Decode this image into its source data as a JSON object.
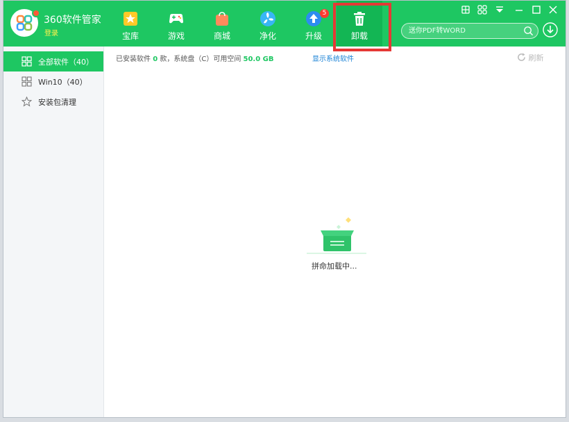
{
  "app": {
    "brand": "360软件管家",
    "login": "登录"
  },
  "tabs": [
    {
      "label": "宝库",
      "icon": "star-icon"
    },
    {
      "label": "游戏",
      "icon": "gamepad-icon"
    },
    {
      "label": "商城",
      "icon": "shopping-bag-icon"
    },
    {
      "label": "净化",
      "icon": "fan-icon"
    },
    {
      "label": "升级",
      "icon": "upgrade-arrow-icon",
      "badge": "5"
    },
    {
      "label": "卸载",
      "icon": "trash-icon",
      "active": true
    }
  ],
  "search": {
    "placeholder": "送你PDF转WORD"
  },
  "sidebar": {
    "items": [
      {
        "label": "全部软件（40）",
        "icon": "grid-icon",
        "active": true
      },
      {
        "label": "Win10（40）",
        "icon": "windows-grid-icon"
      },
      {
        "label": "安装包清理",
        "icon": "star-outline-icon"
      }
    ]
  },
  "status": {
    "prefix": "已安装软件",
    "count": "0",
    "middle": "款，系统盘（C）可用空间",
    "space": "50.0 GB"
  },
  "show_system": "显示系统软件",
  "refresh": "刷新",
  "loading": "拼命加载中...",
  "colors": {
    "brand_green": "#1ec762",
    "highlight_red": "#e53935",
    "link_blue": "#1a82d6"
  }
}
